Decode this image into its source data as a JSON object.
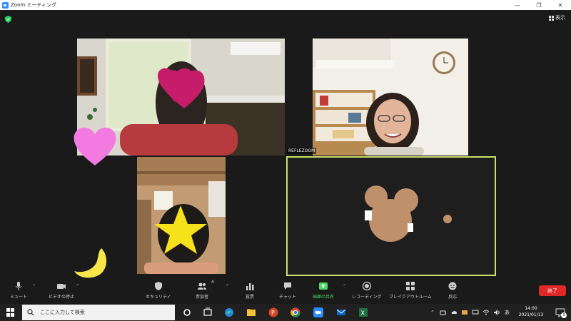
{
  "window": {
    "title": "Zoom ミーティング"
  },
  "meeting": {
    "view_label": "表示",
    "participant_name_tag": "REFLEZOOM"
  },
  "toolbar": {
    "mute_label": "ミュート",
    "video_label": "ビデオの停止",
    "security_label": "セキュリティ",
    "participants_label": "参加者",
    "participants_count": "4",
    "poll_label": "投票",
    "chat_label": "チャット",
    "share_label": "画面の共有",
    "record_label": "レコーディング",
    "breakout_label": "ブレイクアウトルーム",
    "reactions_label": "反応",
    "end_label": "終了"
  },
  "taskbar": {
    "search_placeholder": "ここに入力して検索",
    "time": "14:00",
    "date": "2021/01/13",
    "notification_count": "3",
    "ime_indicator": "あ"
  },
  "colors": {
    "active_speaker_border": "#c8e06a",
    "end_button": "#e02828",
    "share_green": "#4cd964"
  }
}
